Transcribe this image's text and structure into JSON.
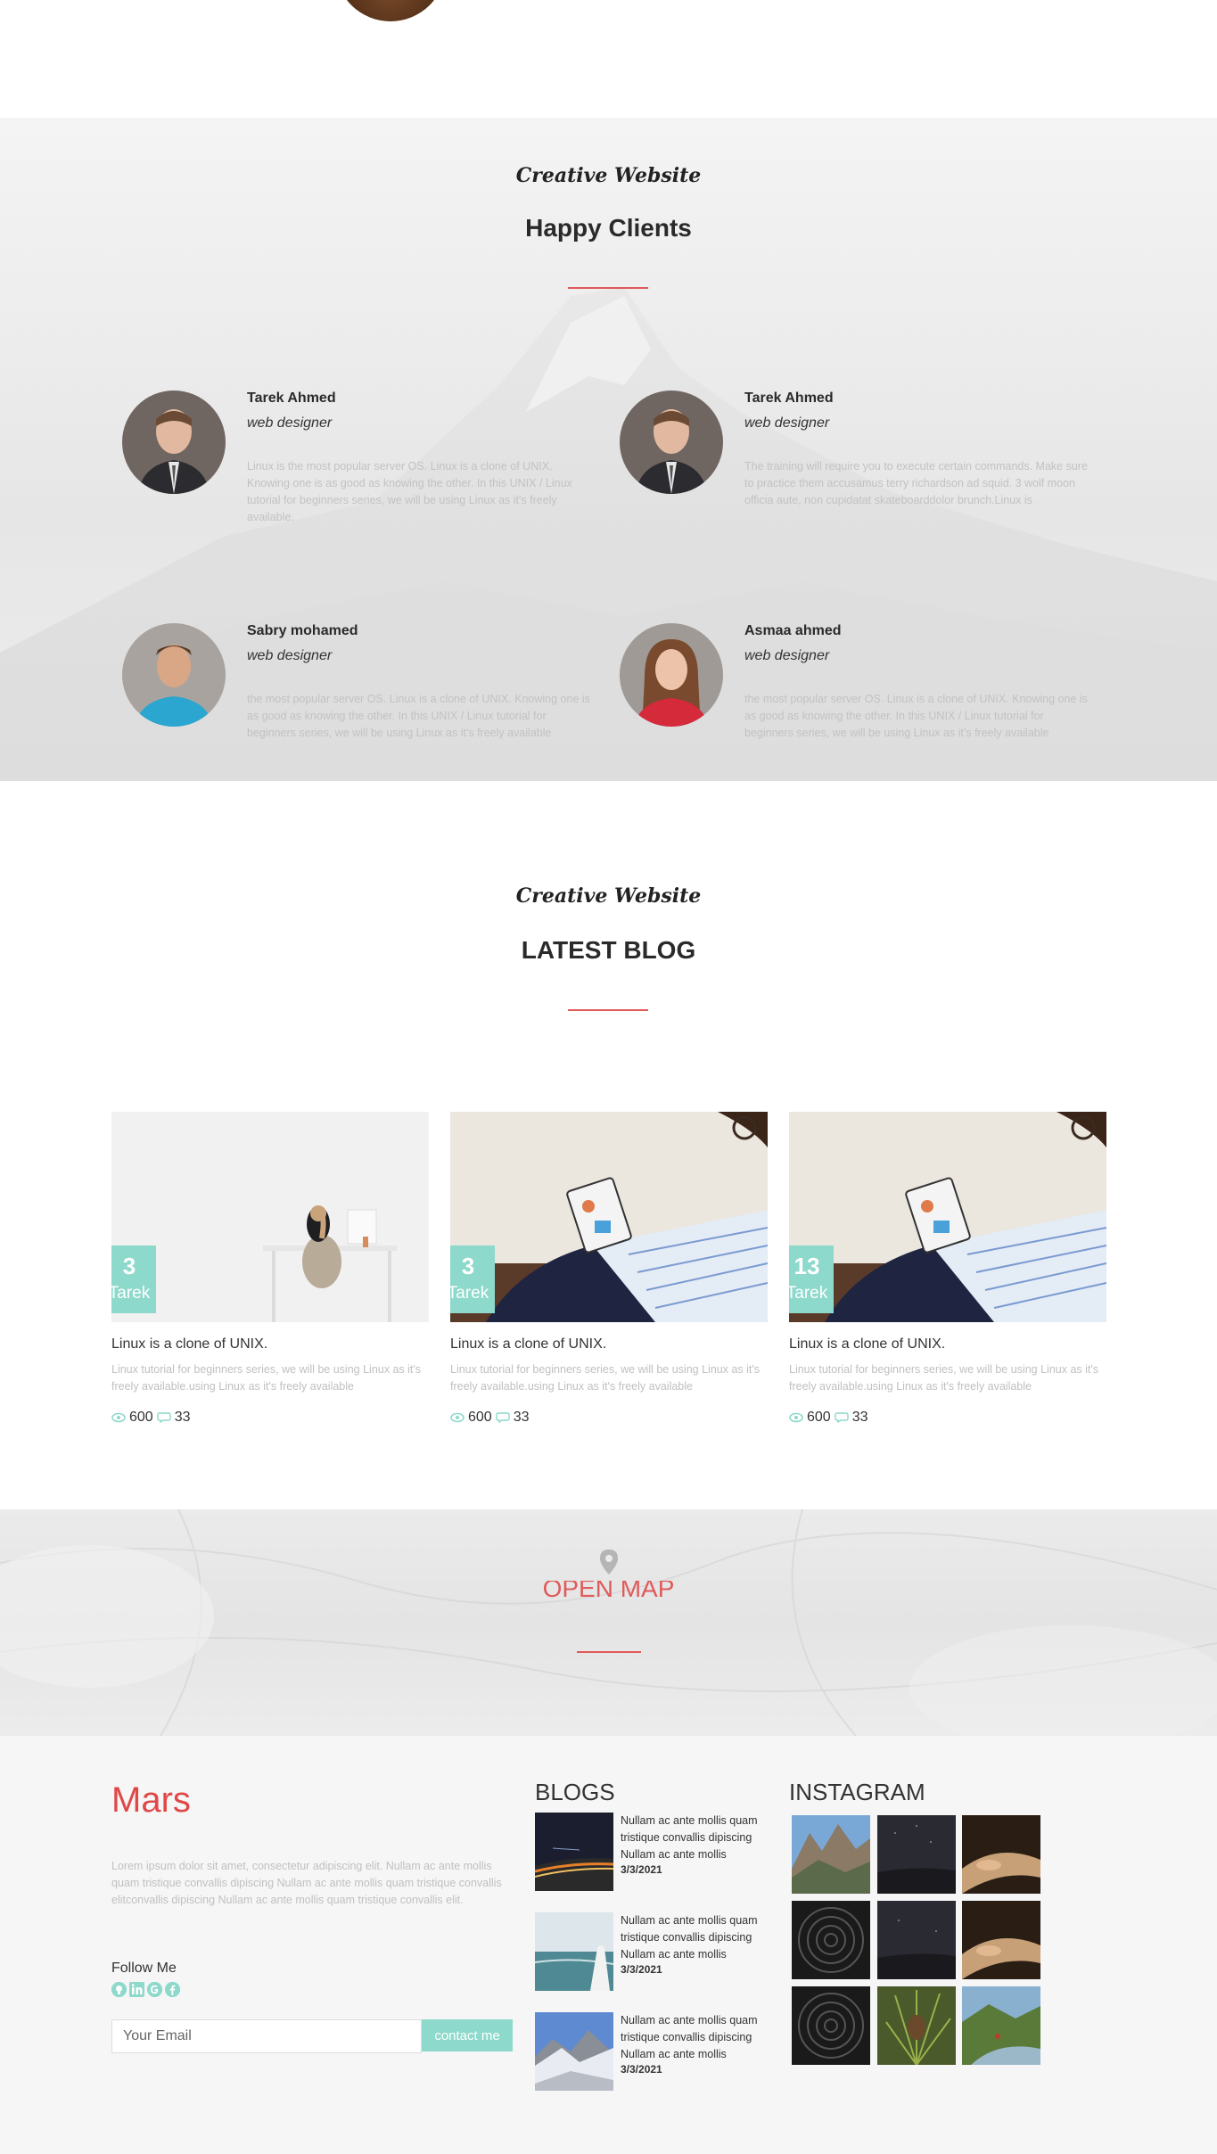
{
  "clients_section": {
    "subtitle": "Creative Website",
    "title": "Happy Clients",
    "clients": [
      {
        "name": "Tarek Ahmed",
        "role": "web designer",
        "text": "Linux is the most popular server OS. Linux is a clone of UNIX. Knowing one is as good as knowing the other. In this UNIX / Linux tutorial for beginners series, we will be using Linux as it's freely available."
      },
      {
        "name": "Tarek Ahmed",
        "role": "web designer",
        "text": "The training will require you to execute certain commands. Make sure to practice them accusamus terry richardson ad squid. 3 wolf moon officia aute, non cupidatat skateboarddolor brunch.Linux is"
      },
      {
        "name": "Sabry mohamed",
        "role": "web designer",
        "text": "the most popular server OS. Linux is a clone of UNIX. Knowing one is as good as knowing the other. In this UNIX / Linux tutorial for beginners series, we will be using Linux as it's freely available"
      },
      {
        "name": "Asmaa ahmed",
        "role": "web designer",
        "text": "the most popular server OS. Linux is a clone of UNIX. Knowing one is as good as knowing the other. In this UNIX / Linux tutorial for beginners series, we will be using Linux as it's freely available"
      }
    ]
  },
  "blog_section": {
    "subtitle": "Creative Website",
    "title": "LATEST BLOG",
    "posts": [
      {
        "day": "3",
        "author": "Tarek",
        "title": "Linux is a clone of UNIX.",
        "desc": "Linux tutorial for beginners series, we will be using Linux as it's freely available.using Linux as it's freely available",
        "views": "600",
        "comments": "33"
      },
      {
        "day": "3",
        "author": "Tarek",
        "title": "Linux is a clone of UNIX.",
        "desc": "Linux tutorial for beginners series, we will be using Linux as it's freely available.using Linux as it's freely available",
        "views": "600",
        "comments": "33"
      },
      {
        "day": "13",
        "author": "Tarek",
        "title": "Linux is a clone of UNIX.",
        "desc": "Linux tutorial for beginners series, we will be using Linux as it's freely available.using Linux as it's freely available",
        "views": "600",
        "comments": "33"
      }
    ]
  },
  "map": {
    "label": "OPEN MAP",
    "icon": "map-pin-icon"
  },
  "footer": {
    "brand": "Mars",
    "about": "Lorem ipsum dolor sit amet, consectetur adipiscing elit. Nullam ac ante mollis quam tristique convallis dipiscing Nullam ac ante mollis quam tristique convallis elitconvallis dipiscing Nullam ac ante mollis quam tristique convallis elit.",
    "follow_label": "Follow Me",
    "socials": [
      "github-icon",
      "linkedin-icon",
      "google-icon",
      "facebook-icon"
    ],
    "email_placeholder": "Your Email",
    "contact_label": "contact me",
    "blogs_heading": "BLOGS",
    "blogs": [
      {
        "text": "Nullam ac ante mollis quam tristique convallis dipiscing Nullam ac ante mollis",
        "date": "3/3/2021"
      },
      {
        "text": "Nullam ac ante mollis quam tristique convallis dipiscing Nullam ac ante mollis",
        "date": "3/3/2021"
      },
      {
        "text": "Nullam ac ante mollis quam tristique convallis dipiscing Nullam ac ante mollis",
        "date": "3/3/2021"
      }
    ],
    "instagram_heading": "INSTAGRAM"
  },
  "colors": {
    "accent": "#8dd9cb",
    "brand_red": "#e04848",
    "divider_red": "#e05a5a"
  }
}
